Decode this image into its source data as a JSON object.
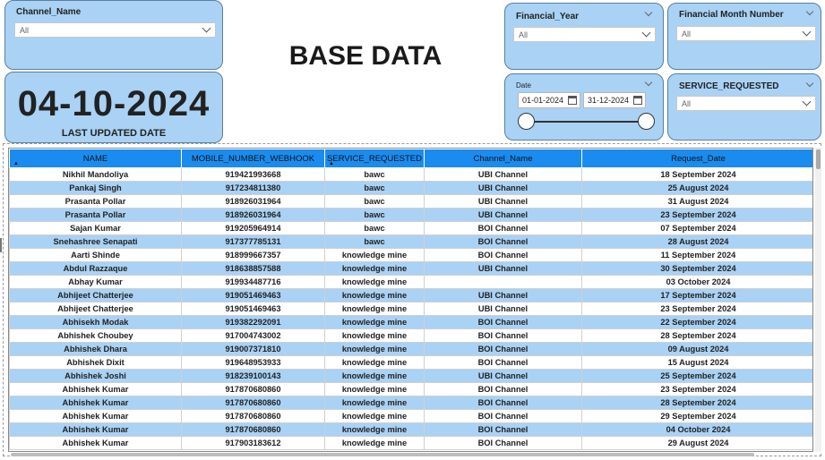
{
  "channel_slicer": {
    "title": "Channel_Name",
    "value": "All"
  },
  "updated_card": {
    "date": "04-10-2024",
    "label": "LAST UPDATED DATE"
  },
  "page_title": "BASE DATA",
  "financial_year": {
    "title": "Financial_Year",
    "value": "All"
  },
  "financial_month": {
    "title": "Financial Month Number",
    "value": "All"
  },
  "date_slicer": {
    "title": "Date",
    "start": "01-01-2024",
    "end": "31-12-2024"
  },
  "service_slicer": {
    "title": "SERVICE_REQUESTED",
    "value": "All"
  },
  "table": {
    "columns": [
      "NAME",
      "MOBILE_NUMBER_WEBHOOK",
      "SERVICE_REQUESTED",
      "Channel_Name",
      "Request_Date"
    ],
    "rows": [
      [
        "Nikhil Mandoliya",
        "919421993668",
        "bawc",
        "UBI Channel",
        "18 September 2024"
      ],
      [
        "Pankaj Singh",
        "917234811380",
        "bawc",
        "UBI Channel",
        "25 August 2024"
      ],
      [
        "Prasanta Pollar",
        "918926031964",
        "bawc",
        "UBI Channel",
        "31 August 2024"
      ],
      [
        "Prasanta Pollar",
        "918926031964",
        "bawc",
        "UBI Channel",
        "23 September 2024"
      ],
      [
        "Sajan Kumar",
        "919205964914",
        "bawc",
        "BOI Channel",
        "07 September 2024"
      ],
      [
        "Snehashree Senapati",
        "917377785131",
        "bawc",
        "BOI Channel",
        "28 August 2024"
      ],
      [
        "Aarti Shinde",
        "918999667357",
        "knowledge mine",
        "BOI Channel",
        "11 September 2024"
      ],
      [
        "Abdul Razzaque",
        "918638857588",
        "knowledge mine",
        "UBI Channel",
        "30 September 2024"
      ],
      [
        "Abhay Kumar",
        "919934487716",
        "knowledge mine",
        "",
        "03 October 2024"
      ],
      [
        "Abhijeet Chatterjee",
        "919051469463",
        "knowledge mine",
        "UBI Channel",
        "17 September 2024"
      ],
      [
        "Abhijeet Chatterjee",
        "919051469463",
        "knowledge mine",
        "UBI Channel",
        "23 September 2024"
      ],
      [
        "Abhisekh Modak",
        "919382292091",
        "knowledge mine",
        "BOI Channel",
        "22 September 2024"
      ],
      [
        "Abhishek Choubey",
        "917004743002",
        "knowledge mine",
        "BOI Channel",
        "28 September 2024"
      ],
      [
        "Abhishek Dhara",
        "919007371810",
        "knowledge mine",
        "BOI Channel",
        "09 August 2024"
      ],
      [
        "Abhishek Dixit",
        "919648953933",
        "knowledge mine",
        "BOI Channel",
        "15 August 2024"
      ],
      [
        "Abhishek Joshi",
        "918239100143",
        "knowledge mine",
        "UBI Channel",
        "25 September 2024"
      ],
      [
        "Abhishek Kumar",
        "917870680860",
        "knowledge mine",
        "BOI Channel",
        "23 September 2024"
      ],
      [
        "Abhishek Kumar",
        "917870680860",
        "knowledge mine",
        "BOI Channel",
        "28 September 2024"
      ],
      [
        "Abhishek Kumar",
        "917870680860",
        "knowledge mine",
        "BOI Channel",
        "29 September 2024"
      ],
      [
        "Abhishek Kumar",
        "917870680860",
        "knowledge mine",
        "BOI Channel",
        "04 October 2024"
      ],
      [
        "Abhishek Kumar",
        "917903183612",
        "knowledge mine",
        "BOI Channel",
        "29 August 2024"
      ]
    ]
  },
  "colors": {
    "header_blue": "#1a8cf0",
    "row_alt": "#a9d2f5",
    "card": "#a9d2f5"
  }
}
